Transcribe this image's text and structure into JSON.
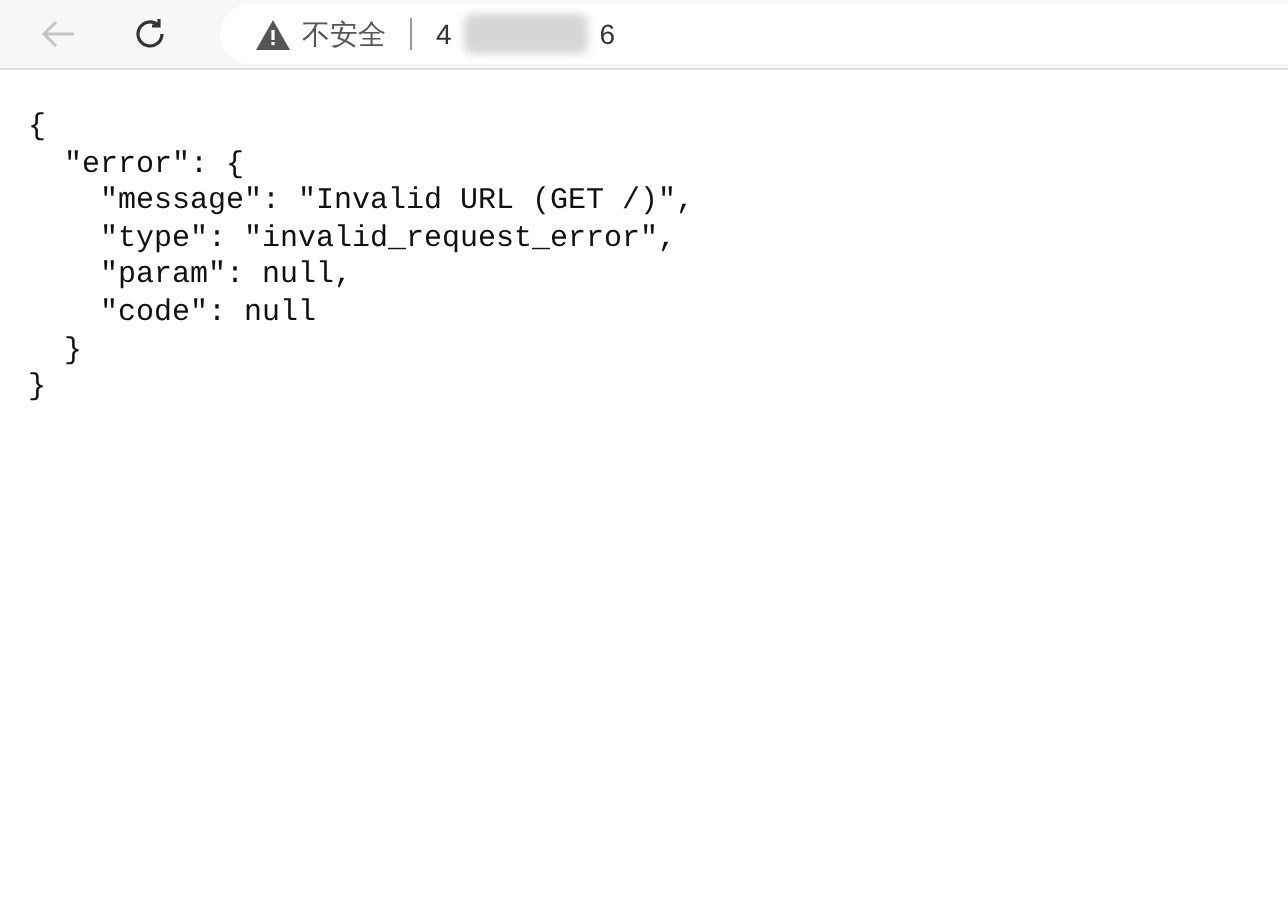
{
  "toolbar": {
    "back_disabled": true,
    "security_label": "不安全",
    "address_start": "4",
    "address_end": "6"
  },
  "content": {
    "open": "{",
    "close": "}",
    "children": [
      {
        "open": "\"error\": {",
        "close": "}",
        "children": [
          {
            "text": "\"message\": \"Invalid URL (GET /)\","
          },
          {
            "text": "\"type\": \"invalid_request_error\","
          },
          {
            "text": "\"param\": null,"
          },
          {
            "text": "\"code\": null"
          }
        ]
      }
    ]
  }
}
